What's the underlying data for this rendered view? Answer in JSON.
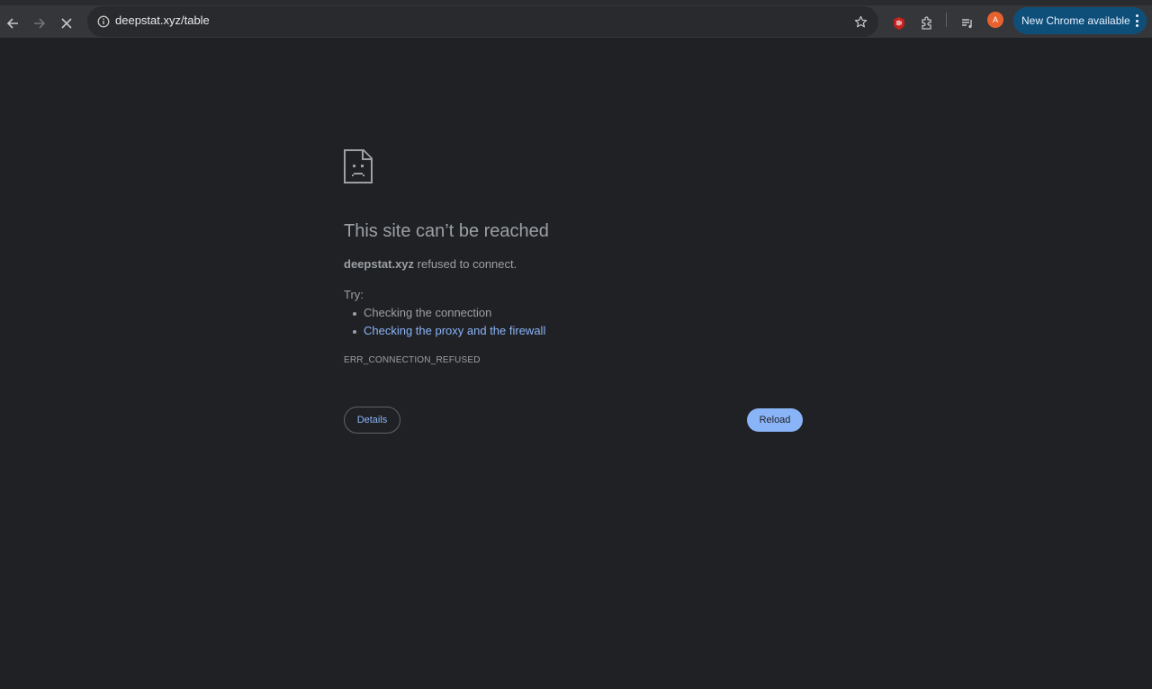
{
  "toolbar": {
    "back_icon": "arrow-left-icon",
    "forward_icon": "arrow-right-icon",
    "stop_icon": "close-icon",
    "url": "deepstat.xyz/table",
    "bookmark_icon": "star-icon",
    "extension_icons": [
      "ublock-icon",
      "puzzle-icon",
      "media-queue-icon"
    ],
    "avatar_letter": "A",
    "update_label": "New Chrome available"
  },
  "error": {
    "icon": "sad-page-icon",
    "title": "This site can’t be reached",
    "host": "deepstat.xyz",
    "message_rest": " refused to connect.",
    "try_label": "Try:",
    "suggestions": [
      "Checking the connection",
      "Checking the proxy and the firewall"
    ],
    "code": "ERR_CONNECTION_REFUSED",
    "details_label": "Details",
    "reload_label": "Reload"
  },
  "colors": {
    "page_bg": "#202124",
    "toolbar_bg": "#35363a",
    "link": "#8ab4f8",
    "update_pill": "#0e4f7a",
    "avatar": "#e8622f"
  }
}
